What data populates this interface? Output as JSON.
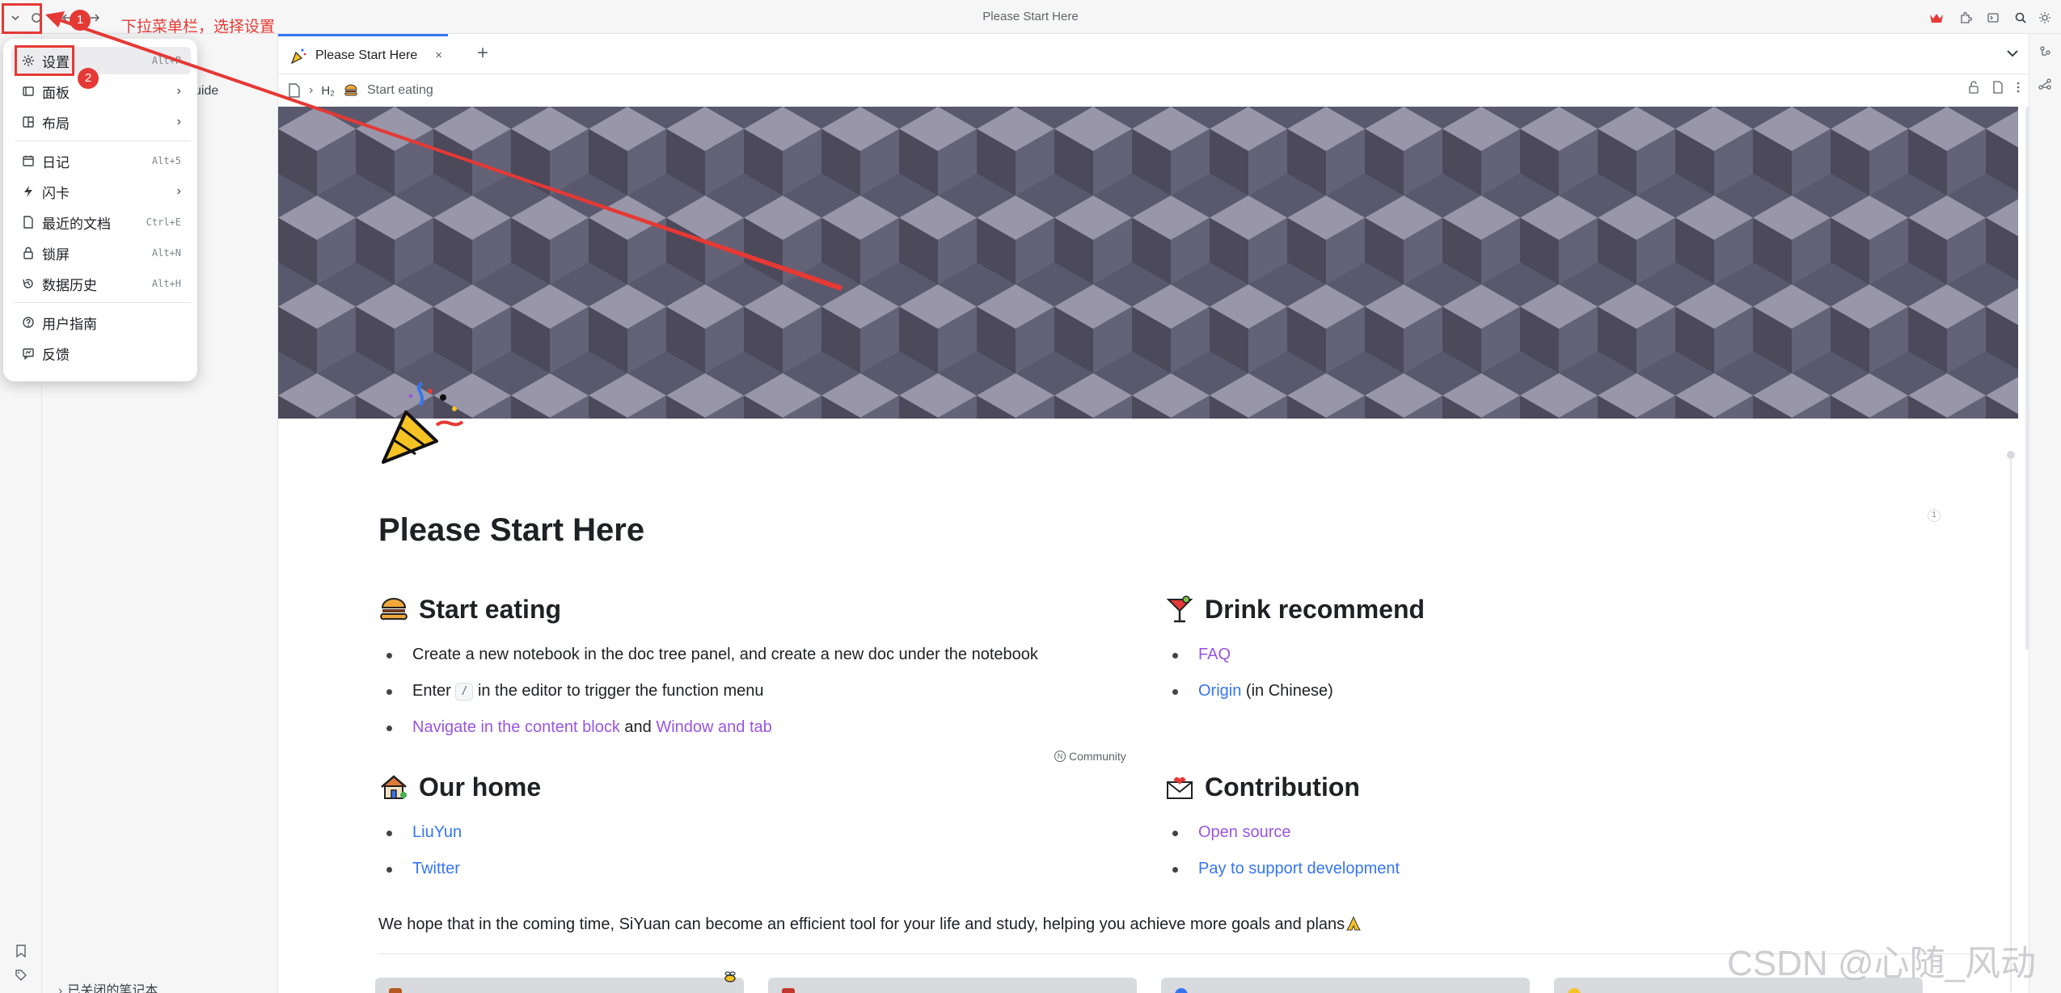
{
  "titlebar": {
    "title": "Please Start Here"
  },
  "filetree": {
    "partial_item": "uide",
    "closed_notebooks": "已关闭的笔记本"
  },
  "tab": {
    "label": "Please Start Here",
    "close": "×",
    "add": "+"
  },
  "breadcrumb": {
    "heading_marker": "H₂",
    "label": "Start eating"
  },
  "menu": {
    "items": [
      {
        "label": "设置",
        "shortcut": "Alt+P",
        "icon": "gear-icon"
      },
      {
        "label": "面板",
        "icon": "panel-icon",
        "submenu": true
      },
      {
        "label": "布局",
        "icon": "layout-icon",
        "submenu": true
      },
      {
        "label": "日记",
        "shortcut": "Alt+5",
        "icon": "calendar-icon"
      },
      {
        "label": "闪卡",
        "icon": "flash-icon",
        "submenu": true
      },
      {
        "label": "最近的文档",
        "shortcut": "Ctrl+E",
        "icon": "recent-doc-icon"
      },
      {
        "label": "锁屏",
        "shortcut": "Alt+N",
        "icon": "lock-icon"
      },
      {
        "label": "数据历史",
        "shortcut": "Alt+H",
        "icon": "history-icon"
      },
      {
        "label": "用户指南",
        "icon": "help-icon"
      },
      {
        "label": "反馈",
        "icon": "feedback-icon"
      }
    ]
  },
  "annotations": {
    "step1": "1",
    "step2": "2",
    "instruction": "下拉菜单栏，选择设置",
    "color": "#e53935"
  },
  "document": {
    "title": "Please Start Here",
    "ref_count": "1",
    "start_eating": {
      "heading": "Start eating",
      "items": [
        "Create a new notebook in the doc tree panel, and create a new doc under the notebook",
        "in the editor to trigger the function menu"
      ],
      "enter_word": "Enter",
      "kbd": "/",
      "link1": "Navigate in the content block",
      "and_word": "and",
      "link2": "Window and tab"
    },
    "community": "Community",
    "drink": {
      "heading": "Drink recommend",
      "faq": "FAQ",
      "origin": "Origin",
      "origin_suffix": "(in Chinese)"
    },
    "home": {
      "heading": "Our home",
      "links": [
        "LiuYun",
        "Twitter"
      ]
    },
    "contribution": {
      "heading": "Contribution",
      "links": [
        "Open source",
        "Pay to support development"
      ]
    },
    "closing": "We hope that in the coming time, SiYuan can become an efficient tool for your life and study, helping you achieve more goals and plans"
  },
  "watermark": "CSDN @心随_风动",
  "colors": {
    "accent": "#3575f0",
    "link_purple": "#9a55e0",
    "banner_dark": "#4a4858",
    "banner_light": "#9795a6"
  }
}
